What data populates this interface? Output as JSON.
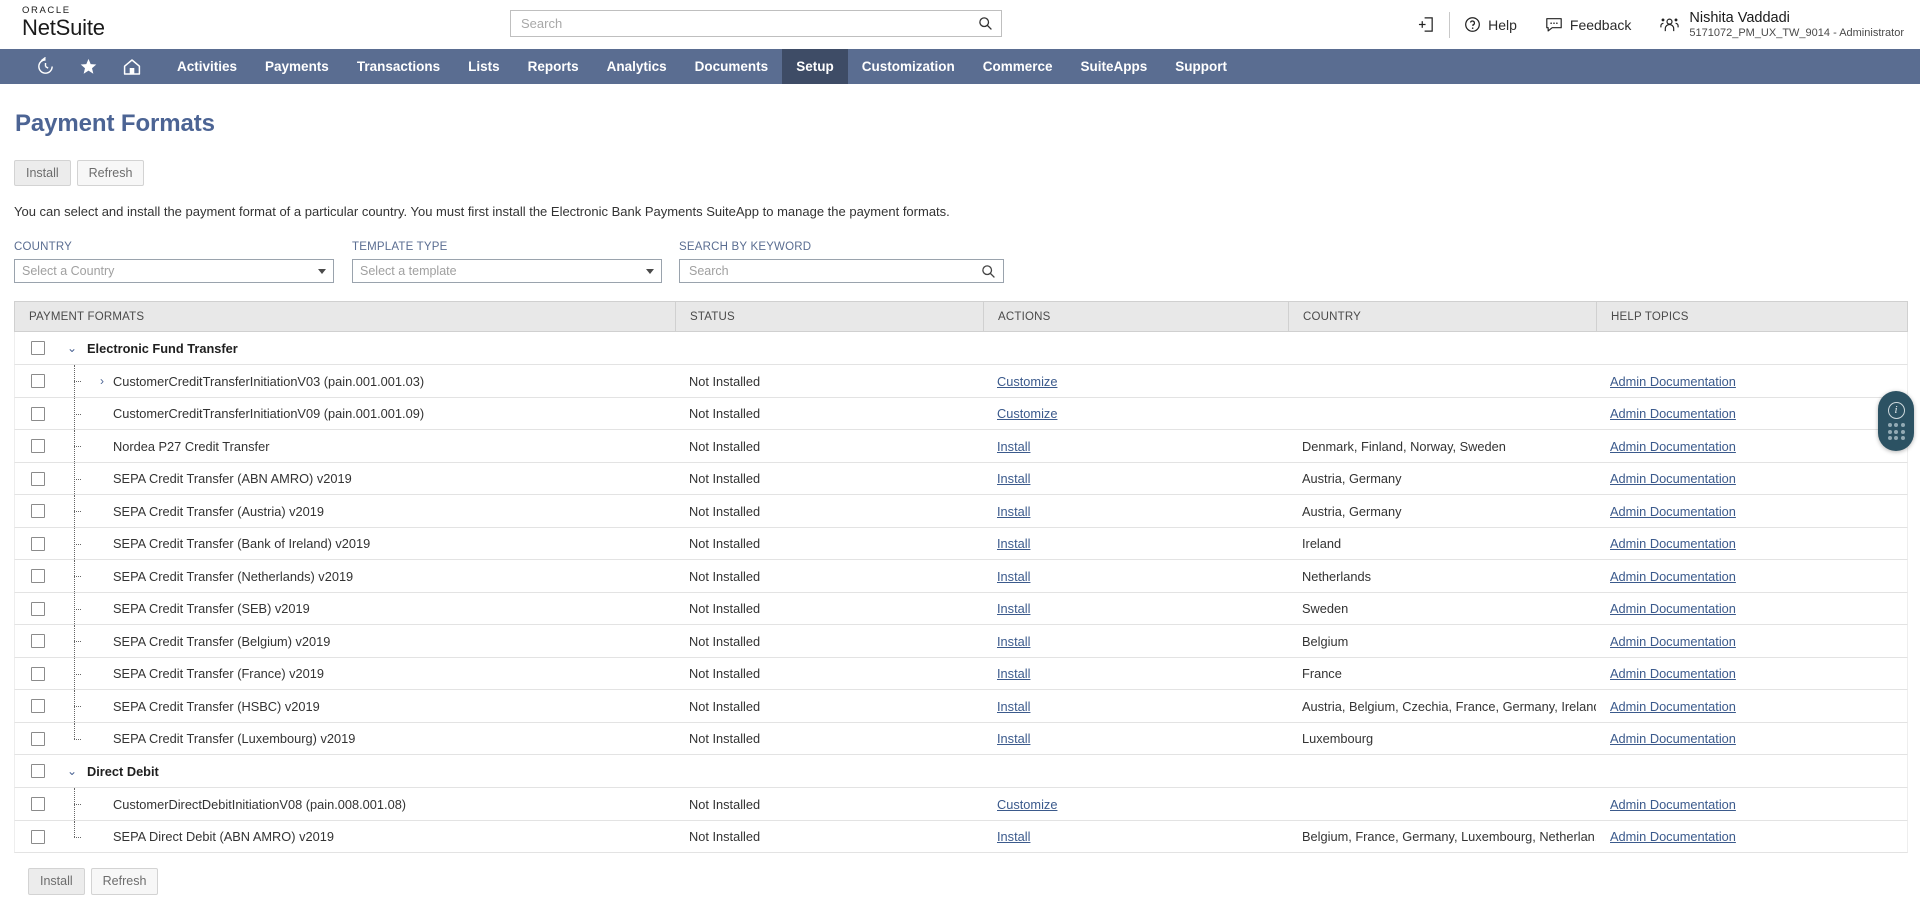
{
  "topbar": {
    "logo_oracle": "ORACLE",
    "logo_product": "NetSuite",
    "search_placeholder": "Search",
    "search_value": "",
    "help_label": "Help",
    "feedback_label": "Feedback",
    "user_name": "Nishita Vaddadi",
    "user_role": "5171072_PM_UX_TW_9014 - Administrator",
    "icons": [
      "history-icon",
      "star-icon",
      "home-icon",
      "sign-in-icon",
      "help-icon",
      "feedback-icon",
      "users-icon"
    ]
  },
  "nav": {
    "items": [
      {
        "label": "Activities",
        "active": false
      },
      {
        "label": "Payments",
        "active": false
      },
      {
        "label": "Transactions",
        "active": false
      },
      {
        "label": "Lists",
        "active": false
      },
      {
        "label": "Reports",
        "active": false
      },
      {
        "label": "Analytics",
        "active": false
      },
      {
        "label": "Documents",
        "active": false
      },
      {
        "label": "Setup",
        "active": true
      },
      {
        "label": "Customization",
        "active": false
      },
      {
        "label": "Commerce",
        "active": false
      },
      {
        "label": "SuiteApps",
        "active": false
      },
      {
        "label": "Support",
        "active": false
      }
    ]
  },
  "page": {
    "title": "Payment Formats",
    "install_label": "Install",
    "refresh_label": "Refresh",
    "description": "You can select and install the payment format of a particular country. You must first install the Electronic Bank Payments SuiteApp to manage the payment formats."
  },
  "filters": {
    "country": {
      "label": "COUNTRY",
      "value": "Select a Country"
    },
    "template": {
      "label": "TEMPLATE TYPE",
      "value": "Select a template"
    },
    "keyword": {
      "label": "SEARCH BY KEYWORD",
      "placeholder": "Search",
      "value": ""
    }
  },
  "table": {
    "headers": [
      "PAYMENT FORMATS",
      "STATUS",
      "ACTIONS",
      "COUNTRY",
      "HELP TOPICS"
    ],
    "groups": [
      {
        "name": "Electronic Fund Transfer",
        "expanded": true,
        "rows": [
          {
            "name": "CustomerCreditTransferInitiationV03 (pain.001.001.03)",
            "status": "Not Installed",
            "action": "Customize",
            "country": "",
            "help": "Admin Documentation",
            "expandable": true
          },
          {
            "name": "CustomerCreditTransferInitiationV09 (pain.001.001.09)",
            "status": "Not Installed",
            "action": "Customize",
            "country": "",
            "help": "Admin Documentation",
            "expandable": false
          },
          {
            "name": "Nordea P27 Credit Transfer",
            "status": "Not Installed",
            "action": "Install",
            "country": "Denmark, Finland, Norway, Sweden",
            "help": "Admin Documentation",
            "expandable": false
          },
          {
            "name": "SEPA Credit Transfer (ABN AMRO) v2019",
            "status": "Not Installed",
            "action": "Install",
            "country": "Austria, Germany",
            "help": "Admin Documentation",
            "expandable": false
          },
          {
            "name": "SEPA Credit Transfer (Austria) v2019",
            "status": "Not Installed",
            "action": "Install",
            "country": "Austria, Germany",
            "help": "Admin Documentation",
            "expandable": false
          },
          {
            "name": "SEPA Credit Transfer (Bank of Ireland) v2019",
            "status": "Not Installed",
            "action": "Install",
            "country": "Ireland",
            "help": "Admin Documentation",
            "expandable": false
          },
          {
            "name": "SEPA Credit Transfer (Netherlands) v2019",
            "status": "Not Installed",
            "action": "Install",
            "country": "Netherlands",
            "help": "Admin Documentation",
            "expandable": false
          },
          {
            "name": "SEPA Credit Transfer (SEB) v2019",
            "status": "Not Installed",
            "action": "Install",
            "country": "Sweden",
            "help": "Admin Documentation",
            "expandable": false
          },
          {
            "name": "SEPA Credit Transfer (Belgium) v2019",
            "status": "Not Installed",
            "action": "Install",
            "country": "Belgium",
            "help": "Admin Documentation",
            "expandable": false
          },
          {
            "name": "SEPA Credit Transfer (France) v2019",
            "status": "Not Installed",
            "action": "Install",
            "country": "France",
            "help": "Admin Documentation",
            "expandable": false
          },
          {
            "name": "SEPA Credit Transfer (HSBC) v2019",
            "status": "Not Installed",
            "action": "Install",
            "country": "Austria, Belgium, Czechia, France, Germany, Ireland,...",
            "help": "Admin Documentation",
            "expandable": false
          },
          {
            "name": "SEPA Credit Transfer (Luxembourg) v2019",
            "status": "Not Installed",
            "action": "Install",
            "country": "Luxembourg",
            "help": "Admin Documentation",
            "expandable": false,
            "last": true
          }
        ]
      },
      {
        "name": "Direct Debit",
        "expanded": true,
        "rows": [
          {
            "name": "CustomerDirectDebitInitiationV08 (pain.008.001.08)",
            "status": "Not Installed",
            "action": "Customize",
            "country": "",
            "help": "Admin Documentation",
            "expandable": false
          },
          {
            "name": "SEPA Direct Debit (ABN AMRO) v2019",
            "status": "Not Installed",
            "action": "Install",
            "country": "Belgium, France, Germany, Luxembourg, Netherlan...",
            "help": "Admin Documentation",
            "expandable": false,
            "last": true
          }
        ]
      }
    ]
  },
  "footer": {
    "install_label": "Install",
    "refresh_label": "Refresh"
  },
  "fab": {
    "info_glyph": "i",
    "name": "help-assistant-widget"
  },
  "colors": {
    "nav_bg": "#5a6d91",
    "nav_active": "#3e4c66",
    "title": "#4c6494",
    "link": "#3b5a8c",
    "fab": "#2c5263"
  }
}
